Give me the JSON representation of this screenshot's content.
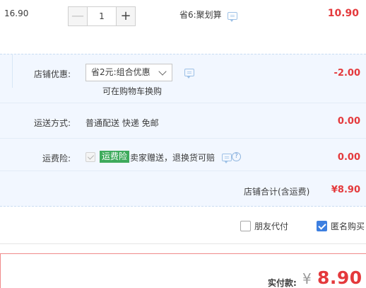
{
  "item": {
    "unit_price": "16.90",
    "quantity": "1",
    "minus_symbol": "—",
    "plus_symbol": "+",
    "promotion": "省6:聚划算",
    "subtotal": "10.90"
  },
  "shop": {
    "coupon_label": "店铺优惠:",
    "coupon_selected": "省2元:组合优惠",
    "coupon_hint": "可在购物车换购",
    "coupon_amount": "-2.00",
    "shipping_label": "运送方式:",
    "shipping_value": "普通配送 快递 免邮",
    "shipping_amount": "0.00",
    "insurance_label": "运费险:",
    "insurance_badge": "运费险",
    "insurance_desc": "卖家赠送，退换货可赔",
    "insurance_amount": "0.00",
    "help_symbol": "?",
    "total_label": "店铺合计(含运费)",
    "total_value": "¥8.90"
  },
  "options": {
    "friend_pay_label": "朋友代付",
    "friend_pay_checked": false,
    "anonymous_label": "匿名购买",
    "anonymous_checked": true
  },
  "payment": {
    "label": "实付款:",
    "currency": "¥",
    "amount": "8.90"
  },
  "colors": {
    "price_red": "#e4393c",
    "panel_bg": "#f2f7ff",
    "checkbox_blue": "#3d7fe0",
    "insurance_green": "#3eaa5c"
  },
  "icons": [
    "message-icon",
    "chevron-down-icon",
    "help-icon",
    "checkmark-icon"
  ]
}
